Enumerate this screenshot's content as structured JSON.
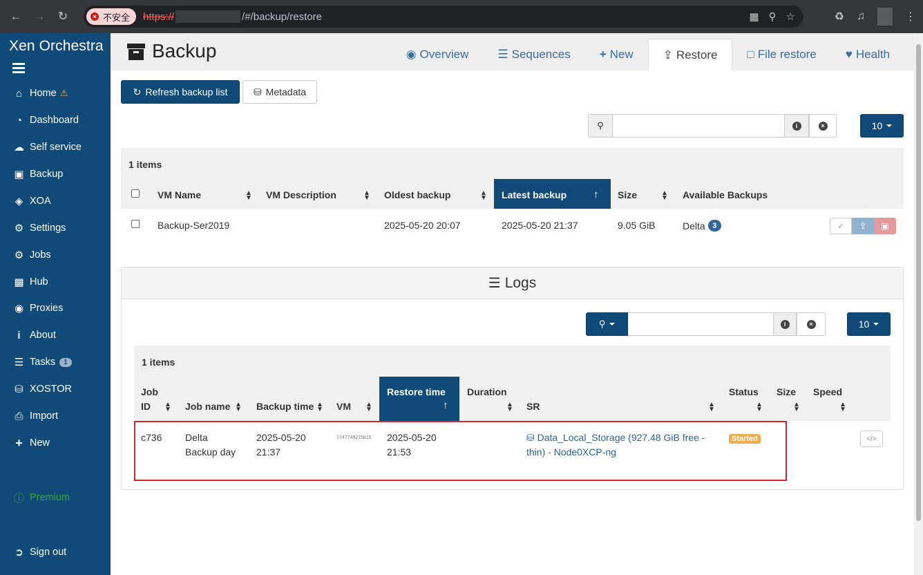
{
  "browser": {
    "insecure_label": "不安全",
    "url_scheme": "https://",
    "url_path": "/#/backup/restore"
  },
  "sidebar": {
    "brand": "Xen Orchestra",
    "items": [
      {
        "label": "Home",
        "icon": "home-icon"
      },
      {
        "label": "Dashboard",
        "icon": "dashboard-icon"
      },
      {
        "label": "Self service",
        "icon": "cloud-icon"
      },
      {
        "label": "Backup",
        "icon": "archive-icon"
      },
      {
        "label": "XOA",
        "icon": "cube-icon"
      },
      {
        "label": "Settings",
        "icon": "gear-icon"
      },
      {
        "label": "Jobs",
        "icon": "gears-icon"
      },
      {
        "label": "Hub",
        "icon": "cubes-icon"
      },
      {
        "label": "Proxies",
        "icon": "globe-icon"
      },
      {
        "label": "About",
        "icon": "info-icon"
      },
      {
        "label": "Tasks",
        "icon": "tasks-icon",
        "badge": "1"
      },
      {
        "label": "XOSTOR",
        "icon": "database-icon"
      },
      {
        "label": "Import",
        "icon": "import-icon"
      },
      {
        "label": "New",
        "icon": "plus-icon"
      }
    ],
    "premium": "Premium",
    "sign_out": "Sign out"
  },
  "header": {
    "title": "Backup",
    "tabs": [
      {
        "label": "Overview"
      },
      {
        "label": "Sequences"
      },
      {
        "label": "New"
      },
      {
        "label": "Restore"
      },
      {
        "label": "File restore"
      },
      {
        "label": "Health"
      }
    ]
  },
  "toolbar": {
    "refresh_label": "Refresh backup list",
    "metadata_label": "Metadata"
  },
  "backups": {
    "page_size": "10",
    "items_count": "1 items",
    "columns": [
      "VM Name",
      "VM Description",
      "Oldest backup",
      "Latest backup",
      "Size",
      "Available Backups"
    ],
    "rows": [
      {
        "vm_name": "Backup-Ser2019",
        "vm_description": "",
        "oldest": "2025-05-20 20:07",
        "latest": "2025-05-20 21:37",
        "size": "9.05 GiB",
        "available": "Delta",
        "available_count": "3"
      }
    ]
  },
  "logs": {
    "title": "Logs",
    "page_size": "10",
    "items_count": "1 items",
    "columns": {
      "job_id_1": "Job",
      "job_id_2": "ID",
      "job_name": "Job name",
      "backup_time": "Backup time",
      "vm": "VM",
      "restore_time": "Restore time",
      "duration": "Duration",
      "sr": "SR",
      "status": "Status",
      "size": "Size",
      "speed": "Speed"
    },
    "rows": [
      {
        "job_id": "c736",
        "job_name_1": "Delta",
        "job_name_2": "Backup day",
        "backup_time_1": "2025-05-20",
        "backup_time_2": "21:37",
        "vm": "1747749215815",
        "restore_time_1": "2025-05-20",
        "restore_time_2": "21:53",
        "sr_1": "Data_Local_Storage (927.48 GiB free -",
        "sr_2": "thin) - Node0XCP-ng",
        "status": "Started"
      }
    ]
  },
  "colors": {
    "sidebar": "#104a79",
    "active_header": "#104a79",
    "status_started": "#f0ad4e",
    "highlight_box": "#d9232d"
  }
}
